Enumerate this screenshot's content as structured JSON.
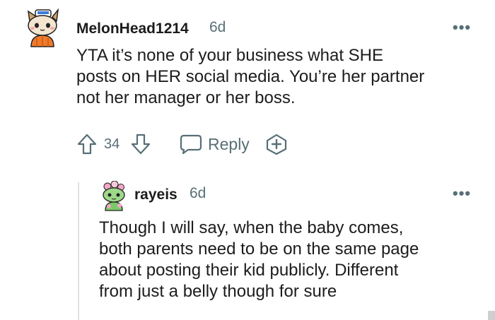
{
  "comments": [
    {
      "username": "MelonHead1214",
      "time": "6d",
      "avatar_icon": "cat-snoo-avatar-icon",
      "body": [
        "YTA it’s none of your business what SHE",
        "posts on HER social media. You’re her partner",
        "not her manager or her boss."
      ],
      "votes": "34",
      "reply_label": "Reply"
    },
    {
      "username": "rayeis",
      "time": "6d",
      "avatar_icon": "green-snoo-avatar-icon",
      "body": [
        "Though I will say, when the baby comes,",
        "both parents need to be on the same page",
        "about posting their kid publicly. Different",
        "from just a belly though for sure"
      ]
    }
  ],
  "more_label": "•••",
  "colors": {
    "text": "#1c1c1c",
    "meta": "#576f76",
    "thread": "#e0e0e0"
  }
}
